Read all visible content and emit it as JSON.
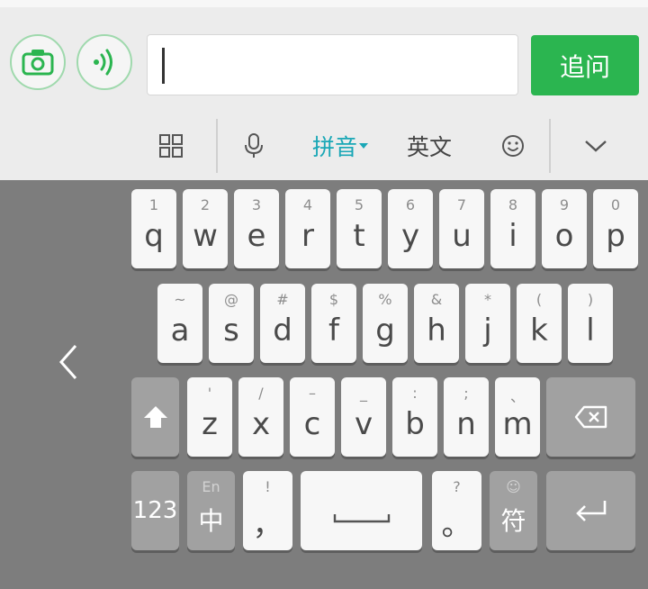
{
  "top": {
    "input_value": "",
    "ask_label": "追问"
  },
  "toolbar": {
    "pinyin_label": "拼音",
    "english_label": "英文"
  },
  "keyboard": {
    "row1": [
      {
        "main": "q",
        "sub": "1"
      },
      {
        "main": "w",
        "sub": "2"
      },
      {
        "main": "e",
        "sub": "3"
      },
      {
        "main": "r",
        "sub": "4"
      },
      {
        "main": "t",
        "sub": "5"
      },
      {
        "main": "y",
        "sub": "6"
      },
      {
        "main": "u",
        "sub": "7"
      },
      {
        "main": "i",
        "sub": "8"
      },
      {
        "main": "o",
        "sub": "9"
      },
      {
        "main": "p",
        "sub": "0"
      }
    ],
    "row2": [
      {
        "main": "a",
        "sub": "~"
      },
      {
        "main": "s",
        "sub": "@"
      },
      {
        "main": "d",
        "sub": "#"
      },
      {
        "main": "f",
        "sub": "$"
      },
      {
        "main": "g",
        "sub": "%"
      },
      {
        "main": "h",
        "sub": "&"
      },
      {
        "main": "j",
        "sub": "*"
      },
      {
        "main": "k",
        "sub": "("
      },
      {
        "main": "l",
        "sub": ")"
      }
    ],
    "row3": [
      {
        "main": "z",
        "sub": "'"
      },
      {
        "main": "x",
        "sub": "/"
      },
      {
        "main": "c",
        "sub": "–"
      },
      {
        "main": "v",
        "sub": "_"
      },
      {
        "main": "b",
        "sub": ":"
      },
      {
        "main": "n",
        "sub": ";"
      },
      {
        "main": "m",
        "sub": "、"
      }
    ],
    "row4": {
      "num_label": "123",
      "lang_main": "中",
      "lang_sub": "En",
      "comma_main": "，",
      "comma_sub": "!",
      "period_main": "。",
      "period_sub": "?",
      "symbol_main": "符",
      "symbol_sub": "☺"
    }
  },
  "icons": {
    "camera": "camera-icon",
    "voice": "voice-icon",
    "grid": "grid-icon",
    "mic": "microphone-icon",
    "emoji": "emoji-icon",
    "collapse": "chevron-down-icon",
    "shift": "shift-icon",
    "backspace": "backspace-icon",
    "enter": "enter-icon",
    "back": "chevron-left-icon"
  },
  "colors": {
    "accent_green": "#2bb550",
    "pinyin_active": "#19a7b6",
    "keyboard_bg": "#7d7d7d"
  }
}
